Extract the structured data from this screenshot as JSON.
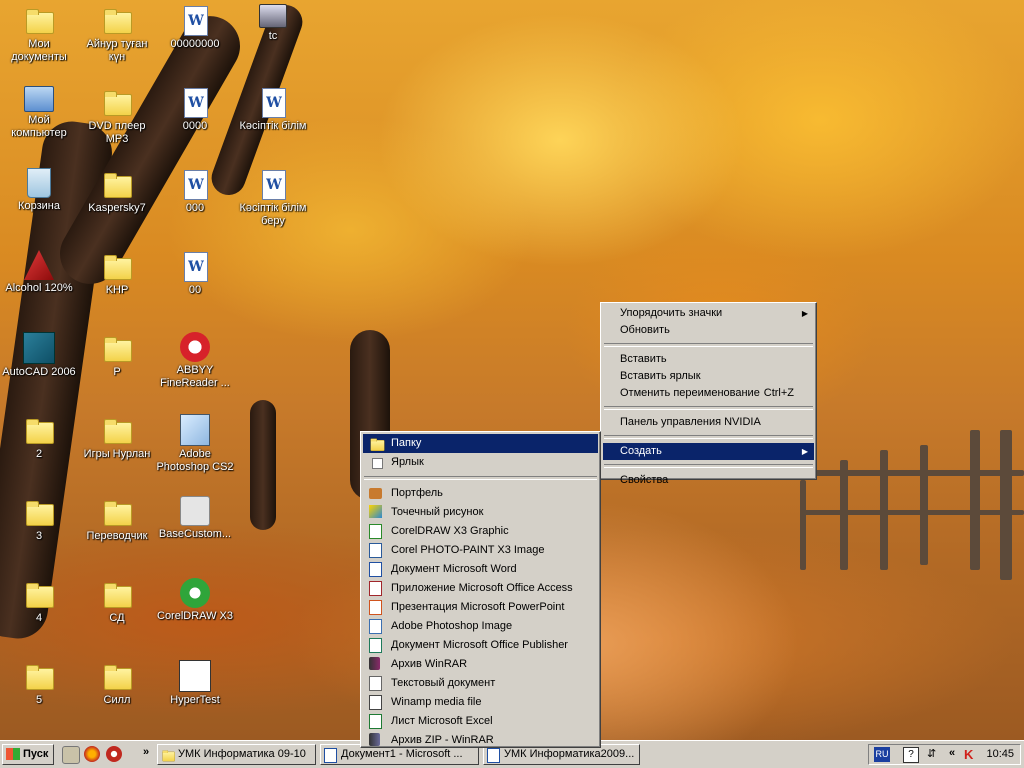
{
  "desktop": {
    "icons": [
      {
        "label": "Мои документы"
      },
      {
        "label": "Мой компьютер"
      },
      {
        "label": "Корзина"
      },
      {
        "label": "Alcohol 120%"
      },
      {
        "label": "AutoCAD 2006"
      },
      {
        "label": "2"
      },
      {
        "label": "3"
      },
      {
        "label": "4"
      },
      {
        "label": "5"
      },
      {
        "label": "Айнур туған күн"
      },
      {
        "label": "DVD плеер MP3"
      },
      {
        "label": "Kaspersky7"
      },
      {
        "label": "KHP"
      },
      {
        "label": "P"
      },
      {
        "label": "Игры Нурлан"
      },
      {
        "label": "Переводчик"
      },
      {
        "label": "СД"
      },
      {
        "label": "Силл"
      },
      {
        "label": "00000000"
      },
      {
        "label": "0000"
      },
      {
        "label": "000"
      },
      {
        "label": "00"
      },
      {
        "label": "ABBYY FineReader ..."
      },
      {
        "label": "Adobe Photoshop CS2"
      },
      {
        "label": "BaseCustom..."
      },
      {
        "label": "CorelDRAW X3"
      },
      {
        "label": "HyperTest"
      },
      {
        "label": "tc"
      },
      {
        "label": "Кәсіптік білім"
      },
      {
        "label": "Кәсіптік білім беру"
      }
    ]
  },
  "context_menu": {
    "items": [
      {
        "label": "Упорядочить значки",
        "submenu": "▶"
      },
      {
        "label": "Обновить"
      },
      {
        "label": "Вставить"
      },
      {
        "label": "Вставить ярлык"
      },
      {
        "label": "Отменить переименование",
        "shortcut": "Ctrl+Z"
      },
      {
        "label": "Панель управления NVIDIA"
      },
      {
        "label": "Создать",
        "submenu": "▶"
      },
      {
        "label": "Свойства"
      }
    ]
  },
  "create_submenu": {
    "items": [
      {
        "label": "Папку"
      },
      {
        "label": "Ярлык"
      },
      {
        "label": "Портфель"
      },
      {
        "label": "Точечный рисунок"
      },
      {
        "label": "CorelDRAW X3 Graphic"
      },
      {
        "label": "Corel PHOTO-PAINT X3 Image"
      },
      {
        "label": "Документ Microsoft Word"
      },
      {
        "label": "Приложение Microsoft Office Access"
      },
      {
        "label": "Презентация Microsoft PowerPoint"
      },
      {
        "label": "Adobe Photoshop Image"
      },
      {
        "label": "Документ Microsoft Office Publisher"
      },
      {
        "label": "Архив WinRAR"
      },
      {
        "label": "Текстовый документ"
      },
      {
        "label": "Winamp media file"
      },
      {
        "label": "Лист Microsoft Excel"
      },
      {
        "label": "Архив ZIP - WinRAR"
      }
    ]
  },
  "taskbar": {
    "start_label": "Пуск",
    "quicklaunch_more": "»",
    "windows": [
      {
        "label": "УМК Информатика 09-10"
      },
      {
        "label": "Документ1 - Microsoft ..."
      },
      {
        "label": "УМК Информатика2009..."
      }
    ],
    "tray": {
      "language": "RU",
      "more": "«",
      "clock": "10:45"
    }
  },
  "colors": {
    "menu_bg": "#d4d0c8",
    "highlight": "#0a246a",
    "taskbar": "#d4d0c8"
  }
}
